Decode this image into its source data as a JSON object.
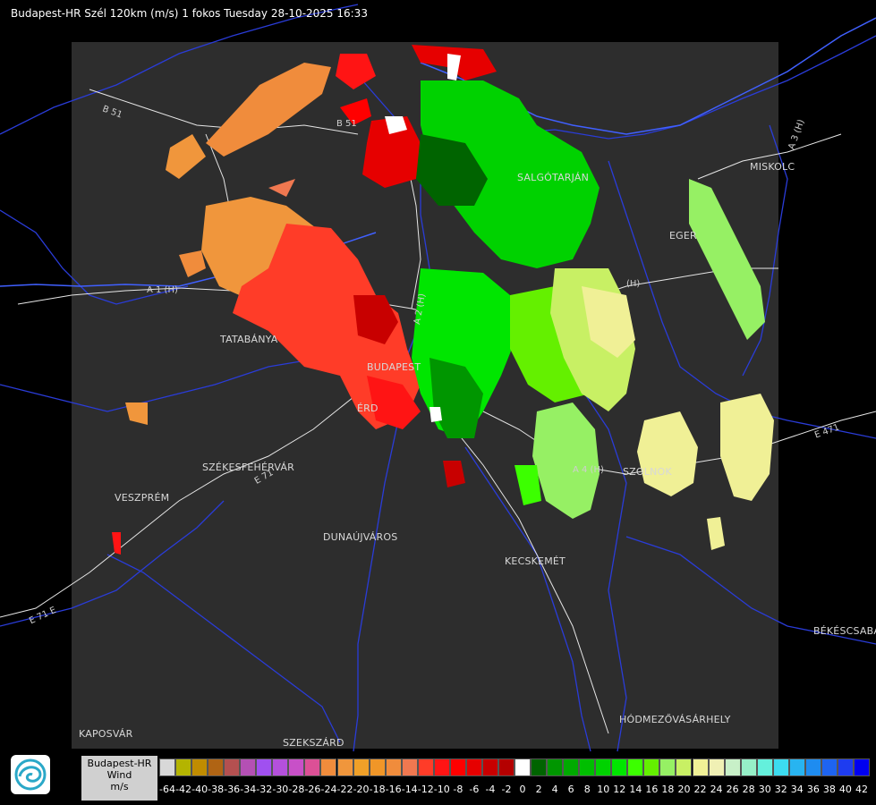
{
  "header": {
    "title": "Budapest-HR Szél 120km (m/s) 1 fokos Tuesday 28-10-2025 16:33"
  },
  "cities": [
    {
      "id": "salgotarjan",
      "label": "SALGÓTARJÁN"
    },
    {
      "id": "miskolc",
      "label": "MISKOLC"
    },
    {
      "id": "eger",
      "label": "EGER"
    },
    {
      "id": "tatabanya",
      "label": "TATABÁNYA"
    },
    {
      "id": "budapest",
      "label": "BUDAPEST"
    },
    {
      "id": "erd",
      "label": "ÉRD"
    },
    {
      "id": "szekesfehervar",
      "label": "SZÉKESFEHÉRVÁR"
    },
    {
      "id": "veszprem",
      "label": "VESZPRÉM"
    },
    {
      "id": "dunaujvaros",
      "label": "DUNAÚJVÁROS"
    },
    {
      "id": "kecskemet",
      "label": "KECSKEMÉT"
    },
    {
      "id": "szolnok",
      "label": "SZOLNOK"
    },
    {
      "id": "bekescsaba",
      "label": "BÉKÉSCSABA"
    },
    {
      "id": "hodmezovasarhely",
      "label": "HÓDMEZŐVÁSÁRHELY"
    },
    {
      "id": "kaposvar",
      "label": "KAPOSVÁR"
    },
    {
      "id": "szekszard",
      "label": "SZEKSZÁRD"
    }
  ],
  "roads": [
    {
      "id": "b51a",
      "label": "B 51"
    },
    {
      "id": "b51b",
      "label": "B 51"
    },
    {
      "id": "m1",
      "label": "A 1 (H)"
    },
    {
      "id": "m2",
      "label": "A 2 (H)"
    },
    {
      "id": "m3",
      "label": "A 3 (H)"
    },
    {
      "id": "e71",
      "label": "E 71"
    },
    {
      "id": "e71b",
      "label": "E 71 E"
    },
    {
      "id": "e471",
      "label": "E 471"
    },
    {
      "id": "m4",
      "label": "A 4 (H)"
    },
    {
      "id": "m3b",
      "label": "(H)"
    }
  ],
  "legend": {
    "title_line1": "Budapest-HR",
    "title_line2": "Wind",
    "title_line3": "m/s",
    "ticks": [
      "-64",
      "-42",
      "-40",
      "-38",
      "-36",
      "-34",
      "-32",
      "-30",
      "-28",
      "-26",
      "-24",
      "-22",
      "-20",
      "-18",
      "-16",
      "-14",
      "-12",
      "-10",
      "-8",
      "-6",
      "-4",
      "-2",
      "0",
      "2",
      "4",
      "6",
      "8",
      "10",
      "12",
      "14",
      "16",
      "18",
      "20",
      "22",
      "24",
      "26",
      "28",
      "30",
      "32",
      "34",
      "36",
      "38",
      "40",
      "42"
    ],
    "colors": [
      "#d8d8d8",
      "#b4b400",
      "#c08c00",
      "#b06414",
      "#b45050",
      "#b450b4",
      "#a050f0",
      "#b450dc",
      "#c850c8",
      "#dc5096",
      "#f08c3c",
      "#f0963c",
      "#f0a028",
      "#f09628",
      "#f08c3c",
      "#f07850",
      "#ff3c28",
      "#ff1414",
      "#ff0000",
      "#e60000",
      "#c80000",
      "#b40000",
      "#ffffff",
      "#006400",
      "#009600",
      "#00aa00",
      "#00be00",
      "#00d200",
      "#00e600",
      "#3cff00",
      "#64f000",
      "#96f064",
      "#c8f064",
      "#f0f096",
      "#f0f0b4",
      "#c8f0c8",
      "#96f0c8",
      "#64f0dc",
      "#3cdcf0",
      "#28b4f0",
      "#1e8cf0",
      "#1e64f0",
      "#1e3cf0",
      "#0000f0"
    ]
  },
  "colors": {
    "background": "#000000",
    "radar_area": "#2d2d2d",
    "rivers": "#1e32c8",
    "roads": "#ffffff",
    "borders": "#3250ff"
  }
}
